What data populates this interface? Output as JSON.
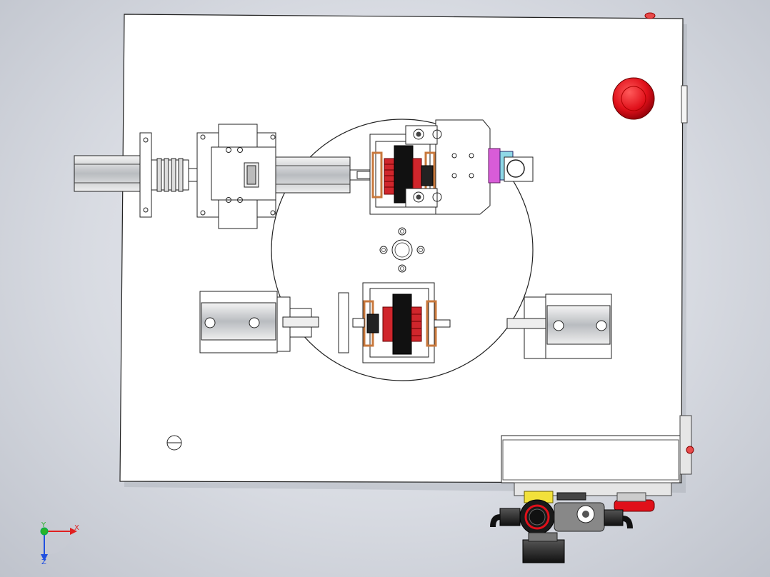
{
  "view": {
    "background_top": "#eef0f4",
    "background_bottom": "#bfc3cc"
  },
  "colors": {
    "plate": "#ffffff",
    "line": "#222222",
    "estop_red": "#e0101a",
    "coil_red": "#d0262c",
    "copper": "#c8783c",
    "magenta_part": "#d85cd8",
    "cyan_part": "#62c8d8",
    "yellow_part": "#f2e13a",
    "axis_x": "#e02020",
    "axis_y": "#28b428",
    "axis_z": "#2050e0"
  },
  "triad": {
    "x_label": "X",
    "y_label": "Y",
    "z_label": "Z"
  },
  "components": [
    "base-plate",
    "rotary-table",
    "linear-actuator-left",
    "motor-assembly-top",
    "motor-assembly-bottom",
    "cylinder-left",
    "cylinder-right",
    "emergency-stop-button",
    "control-box",
    "pneumatic-fitting"
  ]
}
